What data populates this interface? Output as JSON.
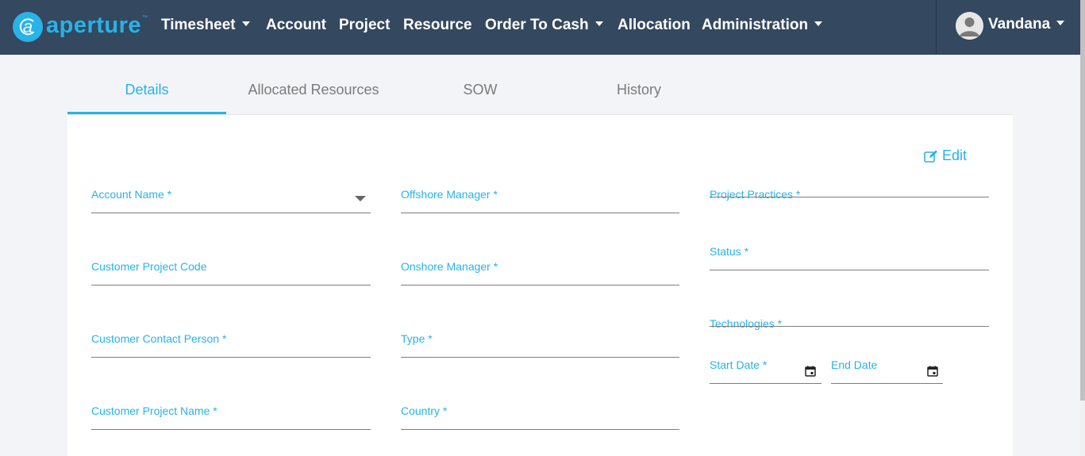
{
  "nav": {
    "brand": "aperture",
    "brand_tm": "™",
    "items": [
      {
        "label": "Timesheet",
        "dropdown": true
      },
      {
        "label": "Account",
        "dropdown": false
      },
      {
        "label": "Project",
        "dropdown": false
      },
      {
        "label": "Resource",
        "dropdown": false
      },
      {
        "label": "Order To Cash",
        "dropdown": true
      },
      {
        "label": "Allocation",
        "dropdown": false
      },
      {
        "label": "Administration",
        "dropdown": true
      }
    ],
    "user": "Vandana"
  },
  "tabs": [
    {
      "label": "Details",
      "active": true
    },
    {
      "label": "Allocated Resources",
      "active": false
    },
    {
      "label": "SOW",
      "active": false
    },
    {
      "label": "History",
      "active": false
    }
  ],
  "edit_label": "Edit",
  "fields": {
    "account_name": "Account Name *",
    "customer_project_code": "Customer Project Code",
    "customer_contact_person": "Customer Contact Person *",
    "customer_project_name": "Customer Project Name *",
    "offshore_manager": "Offshore Manager *",
    "onshore_manager": "Onshore Manager *",
    "type": "Type *",
    "country": "Country *",
    "project_practices": "Project Practices *",
    "status": "Status *",
    "technologies": "Technologies *",
    "start_date": "Start Date *",
    "end_date": "End Date"
  },
  "colors": {
    "navbar": "#34485f",
    "accent": "#27b3e8",
    "background": "#f3f4f8"
  }
}
